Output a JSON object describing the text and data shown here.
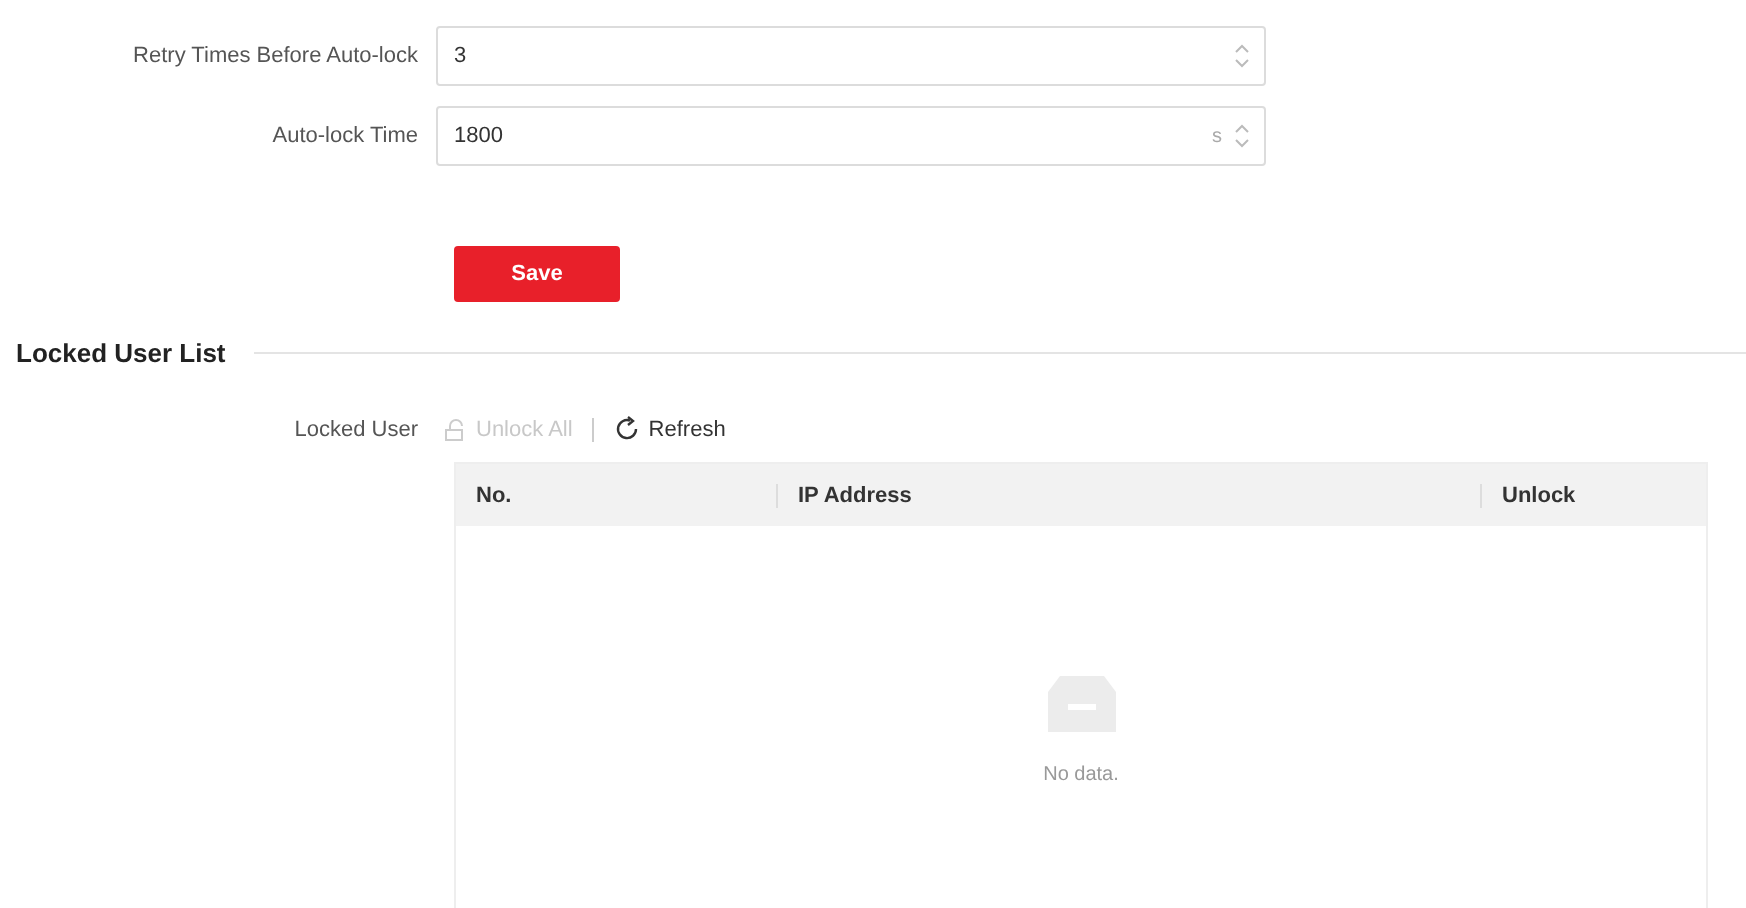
{
  "fields": [
    {
      "label": "Retry Times Before Auto-lock",
      "value": "3"
    },
    {
      "label": "Auto-lock Time",
      "value": "1800",
      "unit": "s"
    }
  ],
  "save_button": "Save",
  "section": {
    "title": "Locked User List"
  },
  "toolbar": {
    "label": "Locked User",
    "actions": [
      {
        "kind": "unlock",
        "label": "Unlock All",
        "disabled": true
      },
      {
        "kind": "refresh",
        "label": "Refresh",
        "disabled": false
      }
    ]
  },
  "table": {
    "columns": [
      "No.",
      "IP Address",
      "Unlock"
    ],
    "empty_text": "No data."
  }
}
